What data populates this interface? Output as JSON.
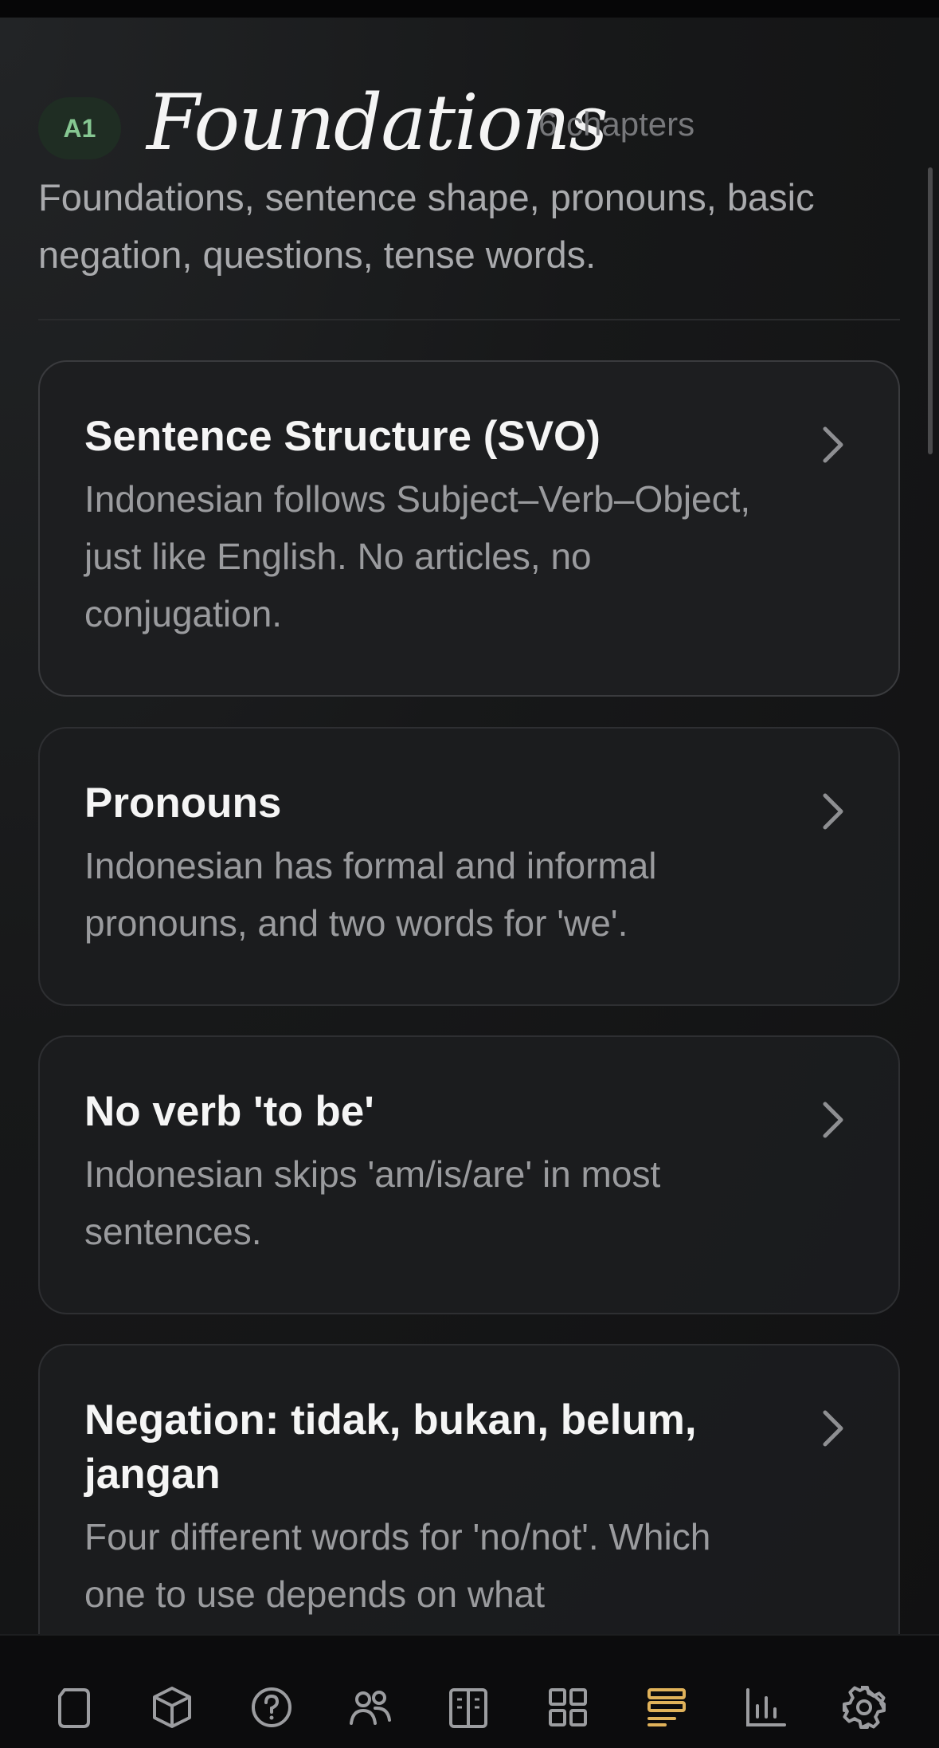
{
  "level": {
    "badge": "A1",
    "title": "Foundations",
    "chapters": "6 chapters",
    "description": "Foundations, sentence shape, pronouns, basic negation, questions, tense words."
  },
  "cards": [
    {
      "title": "Sentence Structure (SVO)",
      "description": "Indonesian follows Subject–Verb–Object, just like English. No articles, no conjugation."
    },
    {
      "title": "Pronouns",
      "description": "Indonesian has formal and informal pronouns, and two words for 'we'."
    },
    {
      "title": "No verb 'to be'",
      "description": "Indonesian skips 'am/is/are' in most sentences."
    },
    {
      "title": "Negation: tidak, bukan, belum, jangan",
      "description": "Four different words for 'no/not'. Which one to use depends on what"
    }
  ],
  "bottom_nav": {
    "items": [
      "page-icon",
      "cube-icon",
      "help-icon",
      "people-icon",
      "book-icon",
      "grid-icon",
      "grammar-icon",
      "chart-icon",
      "gear-icon"
    ],
    "active": "grammar-icon"
  },
  "colors": {
    "background": "#121214",
    "badge_bg": "#1f2d23",
    "badge_text": "#86c792",
    "accent_active": "#e0b25a",
    "icon_inactive": "#9c9da0"
  }
}
